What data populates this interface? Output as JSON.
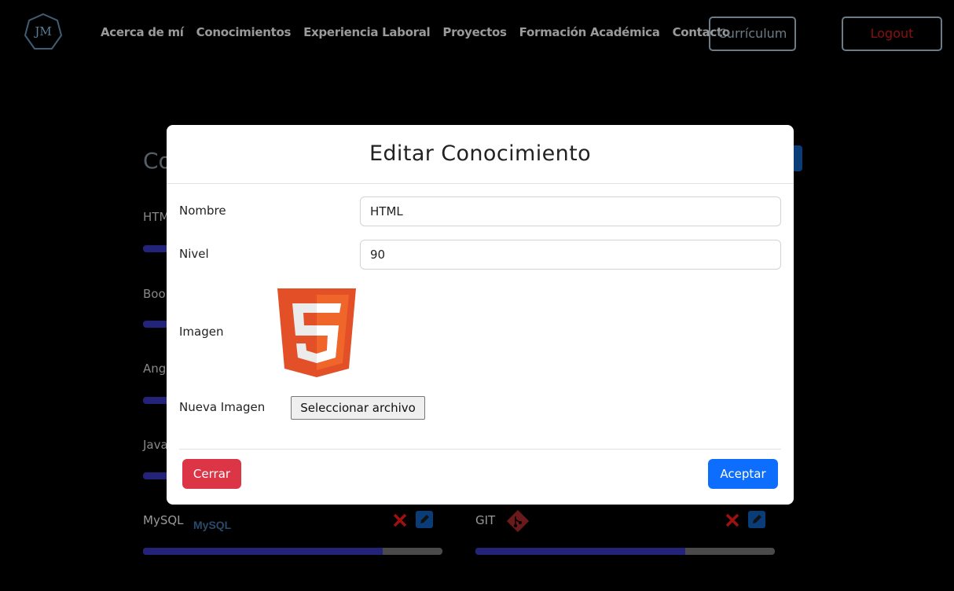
{
  "navbar": {
    "logo_text": "JM",
    "links": [
      "Acerca de mí",
      "Conocimientos",
      "Experiencia Laboral",
      "Proyectos",
      "Formación Académica",
      "Contacto"
    ],
    "cv_label": "Currículum",
    "logout_label": "Logout"
  },
  "background": {
    "section_title": "Co",
    "skills": [
      {
        "label": "HTM"
      },
      {
        "label": "Boo"
      },
      {
        "label": "Ang"
      },
      {
        "label": "Java"
      }
    ],
    "bottom_skills": [
      {
        "label": "MySQL",
        "logo_text": "MySQL",
        "level": 80
      },
      {
        "label": "GIT",
        "level": 70
      }
    ]
  },
  "modal": {
    "title": "Editar Conocimiento",
    "nombre_label": "Nombre",
    "nombre_value": "HTML",
    "nivel_label": "Nivel",
    "nivel_value": "90",
    "imagen_label": "Imagen",
    "nueva_imagen_label": "Nueva Imagen",
    "file_button_label": "Seleccionar archivo",
    "close_label": "Cerrar",
    "accept_label": "Aceptar"
  },
  "colors": {
    "danger": "#dc3545",
    "primary": "#0d6efd",
    "html5_orange": "#e34f26"
  }
}
